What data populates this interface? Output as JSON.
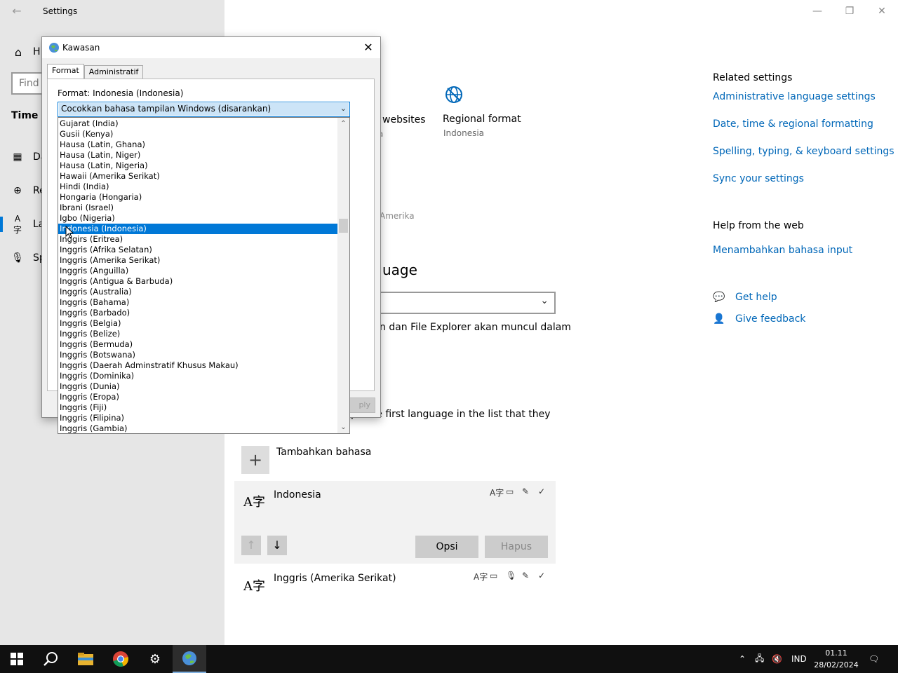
{
  "settings_window": {
    "title": "Settings",
    "back_icon": "back-arrow-icon",
    "controls": {
      "minimize": "minimize-icon",
      "restore": "restore-icon",
      "close": "close-icon"
    }
  },
  "nav": {
    "home_label": "H",
    "find_placeholder": "Find",
    "section_title": "Time &",
    "items": [
      {
        "label": "Da",
        "icon": "calendar-clock-icon"
      },
      {
        "label": "Re",
        "icon": "region-globe-icon"
      },
      {
        "label": "La",
        "icon": "language-icon"
      },
      {
        "label": "Sp",
        "icon": "microphone-icon"
      }
    ]
  },
  "main": {
    "frag_websites": "websites",
    "frag_a": "a",
    "regional_format_title": "Regional format",
    "regional_format_value": "Indonesia",
    "frag_amerika": "Amerika",
    "heading_frag": "uage",
    "explorer_frag": "n dan File Explorer akan muncul dalam",
    "first_lang_frag": "pa   the first language in the list that they",
    "add_language_label": "Tambahkan bahasa",
    "languages": [
      {
        "name": "Indonesia",
        "features": [
          "language-pack-icon",
          "display-icon",
          "handwriting-icon",
          "spellcheck-icon"
        ]
      },
      {
        "name": "Inggris (Amerika Serikat)",
        "features": [
          "language-pack-icon",
          "display-icon",
          "microphone-icon",
          "handwriting-icon",
          "spellcheck-icon"
        ]
      }
    ],
    "options_button": "Opsi",
    "remove_button": "Hapus"
  },
  "related": {
    "heading": "Related settings",
    "links": [
      "Administrative language settings",
      "Date, time & regional formatting",
      "Spelling, typing, & keyboard settings",
      "Sync your settings"
    ],
    "help_heading": "Help from the web",
    "help_link": "Menambahkan bahasa input",
    "get_help": "Get help",
    "give_feedback": "Give feedback"
  },
  "dialog": {
    "title": "Kawasan",
    "tabs": [
      "Format",
      "Administratif"
    ],
    "active_tab": "Format",
    "format_label": "Format: Indonesia (Indonesia)",
    "combo_value": "Cocokkan bahasa tampilan Windows (disarankan)",
    "apply_fragment": "ply",
    "selected_option": "Indonesia (Indonesia)",
    "options": [
      "Gujarat (India)",
      "Gusii (Kenya)",
      "Hausa (Latin, Ghana)",
      "Hausa (Latin, Niger)",
      "Hausa (Latin, Nigeria)",
      "Hawaii (Amerika Serikat)",
      "Hindi (India)",
      "Hongaria (Hongaria)",
      "Ibrani (Israel)",
      "Igbo (Nigeria)",
      "Indonesia (Indonesia)",
      "Inggirs (Eritrea)",
      "Inggris (Afrika Selatan)",
      "Inggris (Amerika Serikat)",
      "Inggris (Anguilla)",
      "Inggris (Antigua & Barbuda)",
      "Inggris (Australia)",
      "Inggris (Bahama)",
      "Inggris (Barbado)",
      "Inggris (Belgia)",
      "Inggris (Belize)",
      "Inggris (Bermuda)",
      "Inggris (Botswana)",
      "Inggris (Daerah Adminstratif Khusus Makau)",
      "Inggris (Dominika)",
      "Inggris (Dunia)",
      "Inggris (Eropa)",
      "Inggris (Fiji)",
      "Inggris (Filipina)",
      "Inggris (Gambia)"
    ]
  },
  "taskbar": {
    "items": [
      "windows-start-icon",
      "search-icon",
      "file-explorer-icon",
      "chrome-icon",
      "settings-gear-icon",
      "region-control-panel-icon"
    ],
    "language": "IND",
    "time": "01.11",
    "date": "28/02/2024"
  },
  "colors": {
    "accent": "#0078d7",
    "link": "#0067b8",
    "nav_bg": "#e6e6e6",
    "taskbar": "#101010"
  }
}
